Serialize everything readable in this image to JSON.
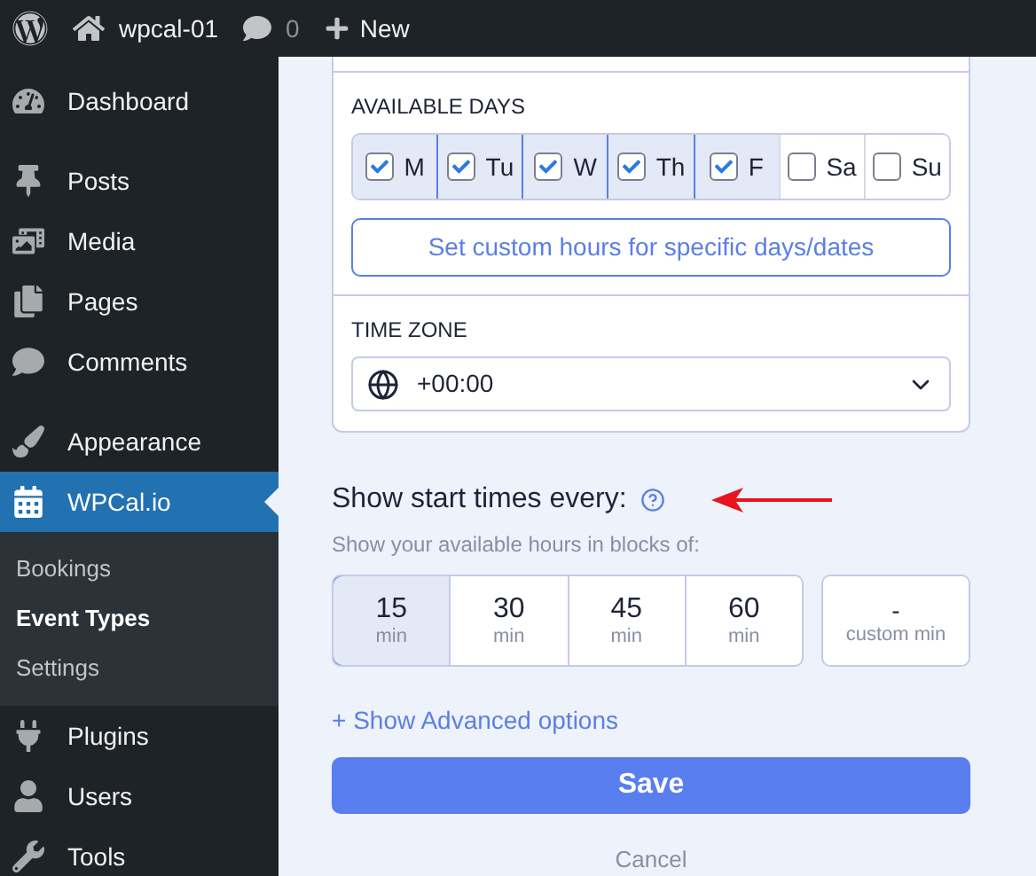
{
  "admin_bar": {
    "site": "wpcal-01",
    "comments": "0",
    "new": "New"
  },
  "sidebar": {
    "groups": [
      [
        {
          "label": "Dashboard",
          "selected": false
        }
      ],
      [
        {
          "label": "Posts",
          "selected": false
        },
        {
          "label": "Media",
          "selected": false
        },
        {
          "label": "Pages",
          "selected": false
        },
        {
          "label": "Comments",
          "selected": false
        }
      ],
      [
        {
          "label": "Appearance",
          "selected": false
        },
        {
          "label": "WPCal.io",
          "selected": true,
          "children": [
            {
              "label": "Bookings",
              "selected": false
            },
            {
              "label": "Event Types",
              "selected": true
            },
            {
              "label": "Settings",
              "selected": false
            }
          ]
        },
        {
          "label": "Plugins",
          "selected": false
        },
        {
          "label": "Users",
          "selected": false
        },
        {
          "label": "Tools",
          "selected": false
        }
      ]
    ]
  },
  "availability": {
    "days_label": "AVAILABLE DAYS",
    "days": [
      {
        "label": "M",
        "checked": true
      },
      {
        "label": "Tu",
        "checked": true
      },
      {
        "label": "W",
        "checked": true
      },
      {
        "label": "Th",
        "checked": true
      },
      {
        "label": "F",
        "checked": true
      },
      {
        "label": "Sa",
        "checked": false
      },
      {
        "label": "Su",
        "checked": false
      }
    ],
    "custom_hours_button": "Set custom hours for specific days/dates",
    "time_zone_label": "TIME ZONE",
    "time_zone": "+00:00"
  },
  "start_times": {
    "title": "Show start times every:",
    "subtitle": "Show your available hours in blocks of:",
    "options": [
      {
        "value": "15",
        "unit": "min",
        "selected": true
      },
      {
        "value": "30",
        "unit": "min",
        "selected": false
      },
      {
        "value": "45",
        "unit": "min",
        "selected": false
      },
      {
        "value": "60",
        "unit": "min",
        "selected": false
      }
    ],
    "custom": {
      "value": "-",
      "unit": "custom min"
    }
  },
  "advanced_link": "+ Show Advanced options",
  "save": "Save",
  "cancel": "Cancel"
}
